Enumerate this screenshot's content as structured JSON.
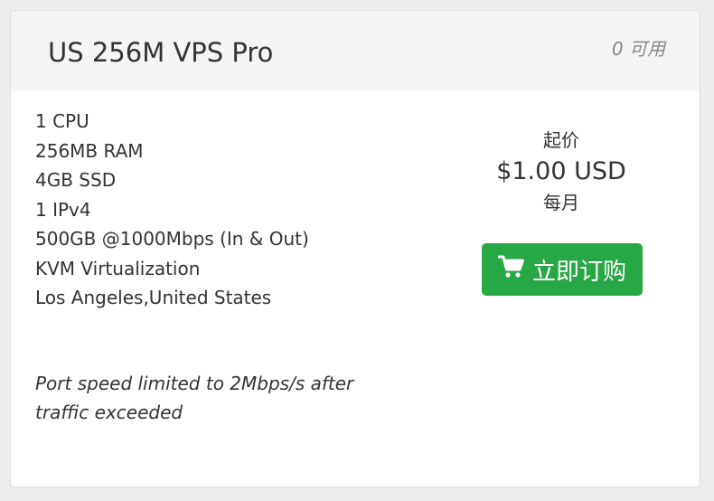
{
  "product": {
    "title": "US 256M VPS Pro",
    "availability": "0 可用"
  },
  "features": [
    "1 CPU",
    "256MB RAM",
    "4GB SSD",
    "1 IPv4",
    "500GB @1000Mbps (In & Out)",
    "KVM Virtualization",
    "Los Angeles,United States"
  ],
  "note": "Port speed limited to 2Mbps/s after traffic exceeded",
  "pricing": {
    "prefix": "起价",
    "amount": "$1.00 USD",
    "cycle": "每月"
  },
  "order_button": {
    "icon": "shopping-cart-icon",
    "label": "立即订购",
    "color": "#28a745"
  },
  "colors": {
    "header_bg": "#f5f5f5",
    "page_bg": "#eeeeee",
    "text": "#333333",
    "muted": "#888888"
  }
}
